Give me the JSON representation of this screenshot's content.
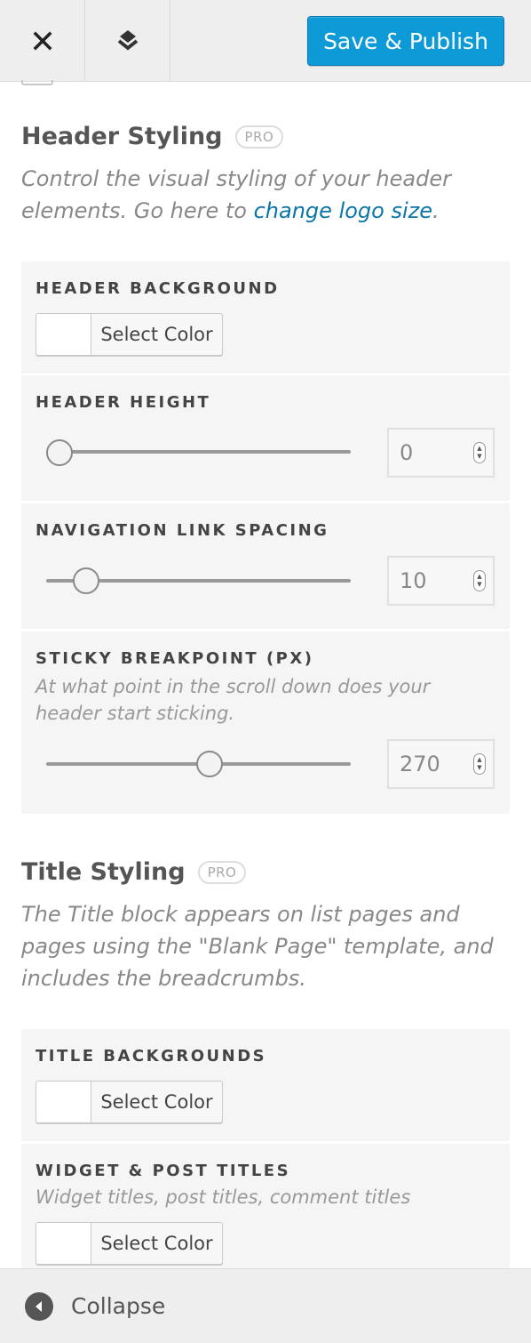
{
  "toolbar": {
    "close_icon": "close-icon",
    "layers_icon": "layers-icon",
    "publish_label": "Save & Publish",
    "accent_color": "#0e9ad6"
  },
  "header_section": {
    "title": "Header Styling",
    "badge": "PRO",
    "desc_prefix": "Control the visual styling of your header elements. Go here to ",
    "desc_link": "change logo size",
    "desc_suffix": "."
  },
  "header_controls": {
    "background": {
      "label": "HEADER BACKGROUND",
      "button": "Select Color"
    },
    "height": {
      "label": "HEADER HEIGHT",
      "value": "0",
      "fraction": 0.0
    },
    "nav_spacing": {
      "label": "NAVIGATION LINK SPACING",
      "value": "10",
      "fraction": 0.1
    },
    "sticky": {
      "label": "STICKY BREAKPOINT (PX)",
      "desc": "At what point in the scroll down does your header start sticking.",
      "value": "270",
      "fraction": 0.53
    }
  },
  "title_section": {
    "title": "Title Styling",
    "badge": "PRO",
    "desc": "The Title block appears on list pages and pages using the \"Blank Page\" template, and includes the breadcrumbs."
  },
  "title_controls": {
    "backgrounds": {
      "label": "TITLE BACKGROUNDS",
      "button": "Select Color"
    },
    "widget_titles": {
      "label": "WIDGET & POST TITLES",
      "desc": "Widget titles, post titles, comment titles",
      "button": "Select Color"
    }
  },
  "footer": {
    "collapse_label": "Collapse"
  }
}
